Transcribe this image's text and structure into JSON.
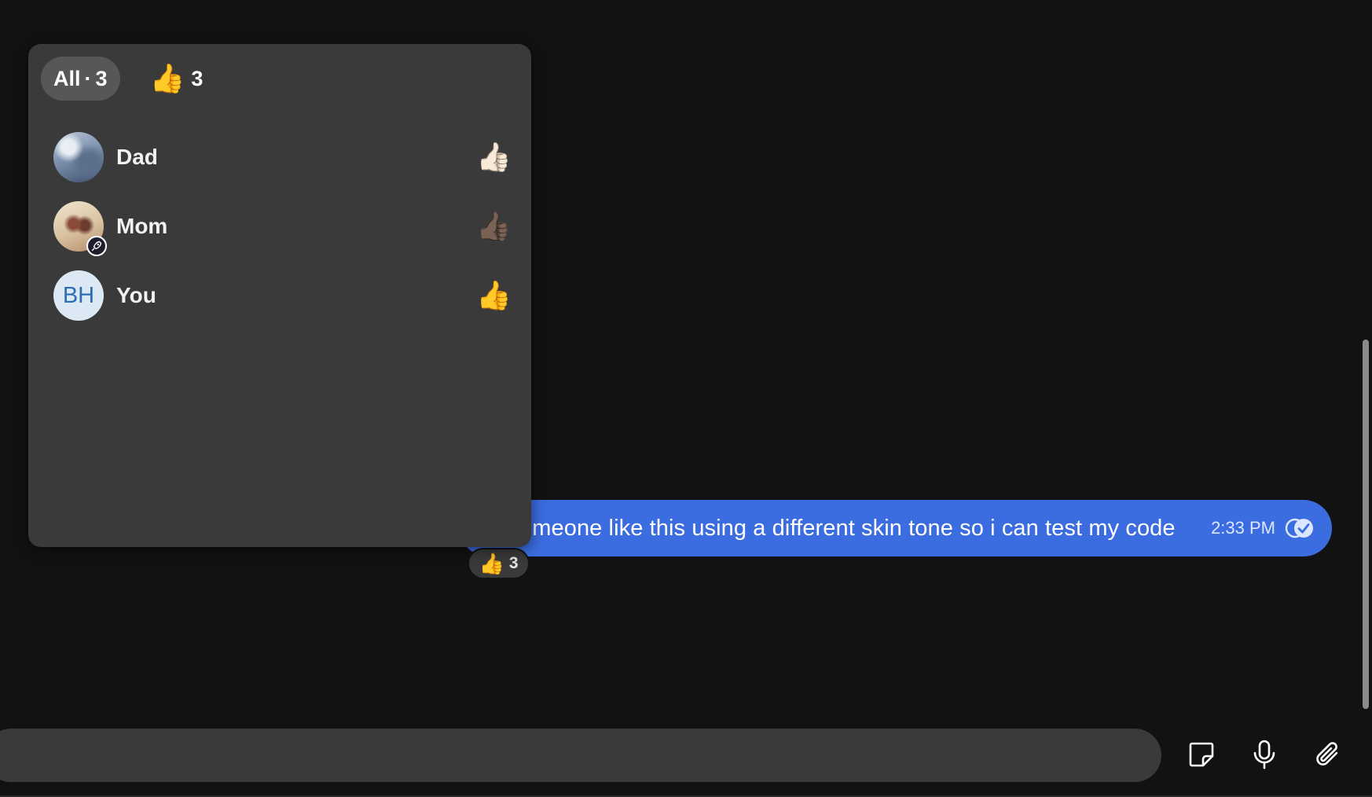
{
  "reactions_panel": {
    "filters": [
      {
        "label": "All",
        "separator": "·",
        "count": "3"
      },
      {
        "emoji": "👍",
        "count": "3"
      }
    ],
    "reactors": [
      {
        "name": "Dad",
        "emoji": "👍🏼",
        "avatar": "photo"
      },
      {
        "name": "Mom",
        "emoji": "👍🏾",
        "avatar": "photo",
        "badge": "rocket-badge-icon"
      },
      {
        "name": "You",
        "emoji": "👍",
        "avatar_initials": "BH"
      }
    ]
  },
  "message": {
    "text": "omeone like this using a different skin tone so i can test my code",
    "time": "2:33 PM",
    "status": "read-check-icon",
    "reaction": {
      "emoji": "👍",
      "count": "3"
    }
  },
  "composer": {
    "placeholder": "",
    "buttons": [
      "sticker-icon",
      "microphone-icon",
      "paperclip-icon"
    ]
  },
  "colors": {
    "background": "#121212",
    "panel": "#3a3a3a",
    "bubble": "#3b6ce0",
    "active_tab": "#575757"
  }
}
